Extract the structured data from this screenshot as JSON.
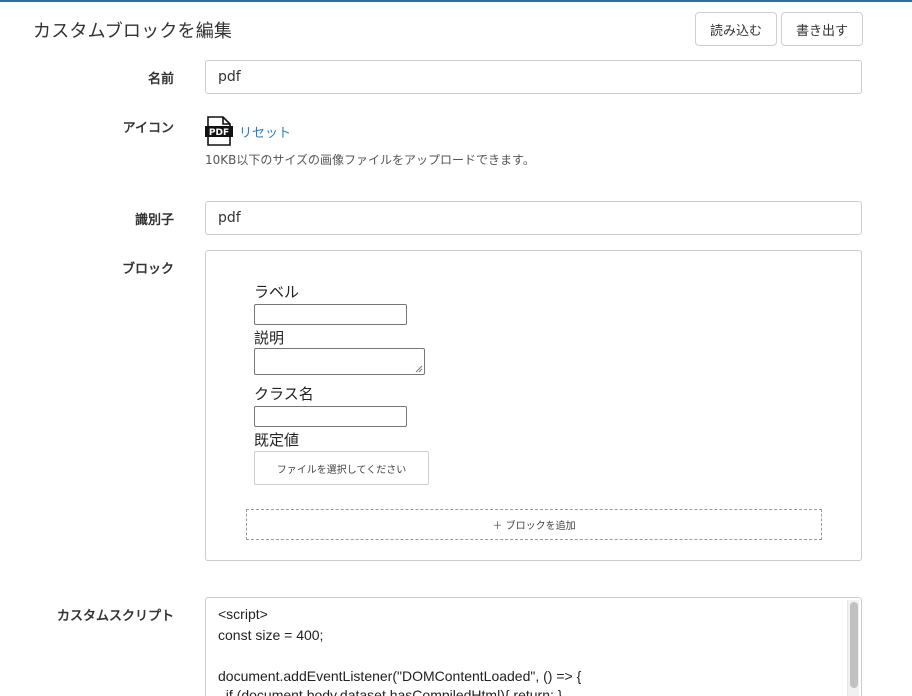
{
  "header": {
    "title": "カスタムブロックを編集",
    "import_label": "読み込む",
    "export_label": "書き出す"
  },
  "form": {
    "name": {
      "label": "名前",
      "value": "pdf"
    },
    "icon": {
      "label": "アイコン",
      "icon_name": "pdf-file-icon",
      "icon_text": "PDF",
      "reset_label": "リセット",
      "help": "10KB以下のサイズの画像ファイルをアップロードできます。"
    },
    "identifier": {
      "label": "識別子",
      "value": "pdf"
    },
    "block": {
      "label": "ブロック",
      "fields": {
        "label_title": "ラベル",
        "description_title": "説明",
        "classname_title": "クラス名",
        "default_title": "既定値"
      },
      "file_button_label": "ファイルを選択してください",
      "add_block_label": "＋ ブロックを追加"
    },
    "script": {
      "label": "カスタムスクリプト",
      "lines": [
        "<script>",
        "const size = 400;",
        "",
        "document.addEventListener(\"DOMContentLoaded\", () => {",
        "  if (document.body.dataset.hasCompiledHtml){ return; }"
      ]
    }
  }
}
